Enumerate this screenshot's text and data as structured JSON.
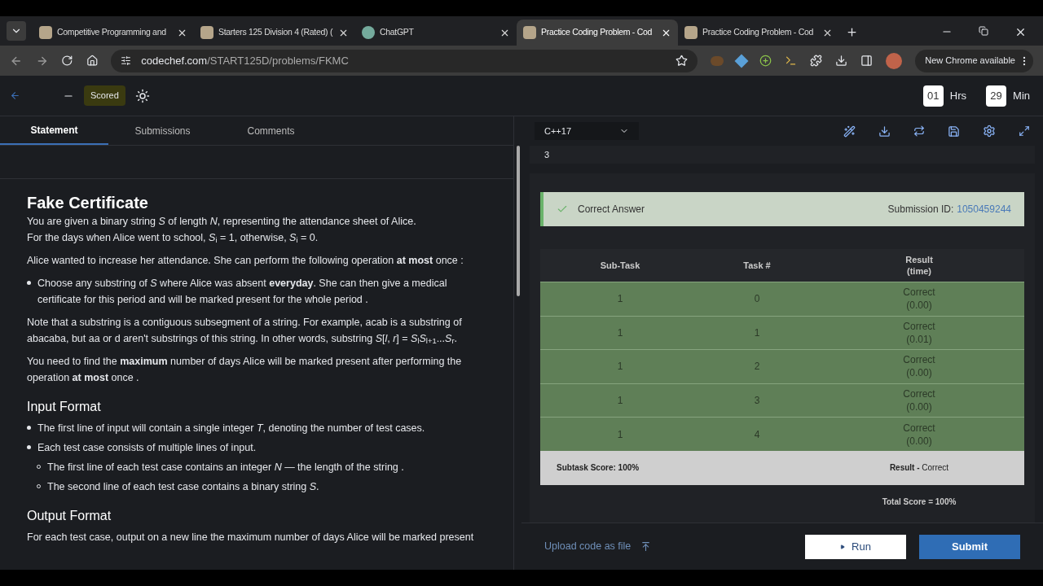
{
  "browser": {
    "tabs": [
      {
        "title": "Competitive Programming and",
        "selected": false
      },
      {
        "title": "Starters 125 Division 4 (Rated) (",
        "selected": false
      },
      {
        "title": "ChatGPT",
        "selected": false
      },
      {
        "title": "Practice Coding Problem - Cod",
        "selected": true
      },
      {
        "title": "Practice Coding Problem - Cod",
        "selected": false
      }
    ],
    "url_domain": "codechef.com",
    "url_path": "/START125D/problems/FKMC",
    "update_label": "New Chrome available"
  },
  "header": {
    "badge": "Scored",
    "timer": [
      {
        "value": "01",
        "unit": "Hrs"
      },
      {
        "value": "29",
        "unit": "Min"
      }
    ]
  },
  "left_tabs": [
    {
      "label": "Statement",
      "selected": true
    },
    {
      "label": "Submissions",
      "selected": false
    },
    {
      "label": "Comments",
      "selected": false
    }
  ],
  "problem": {
    "title": "Fake Certificate",
    "blocks": [
      {
        "kind": "para",
        "lines": [
          "You are given a binary string *S* of length *N*, representing the attendance sheet of Alice.",
          "For the days when Alice went to school, *S*$_{i}$ = 1, otherwise, *S*$_{i}$ = 0."
        ]
      },
      {
        "kind": "para",
        "lines": [
          "Alice wanted to increase her attendance. She can perform the following operation **at most** once :"
        ]
      },
      {
        "kind": "bullets",
        "items": [
          {
            "text": "Choose any substring of *S* where Alice was absent **everyday**. She can then give a medical certificate for this period and will be marked present for the whole period ."
          }
        ]
      },
      {
        "kind": "para",
        "lines": [
          "Note that a substring is a contiguous subsegment of a string. For example, acab is a substring of abacaba, but aa or d aren't substrings of this string. In other words, substring *S*[*l*, *r*] = *S*$_{l}$*S*$_{l+1}$...*S*$_{r}$."
        ]
      },
      {
        "kind": "para",
        "lines": [
          "You need to find the **maximum** number of days Alice will be marked present after performing the operation **at most** once ."
        ]
      },
      {
        "kind": "heading",
        "text": "Input Format"
      },
      {
        "kind": "bullets",
        "items": [
          {
            "text": "The first line of input will contain a single integer *T*, denoting the number of test cases."
          },
          {
            "text": "Each test case consists of multiple lines of input.",
            "children": [
              {
                "text": "The first line of each test case contains an integer *N* — the length of the string ."
              },
              {
                "text": "The second line of each test case contains a binary string *S*."
              }
            ]
          }
        ]
      },
      {
        "kind": "heading",
        "text": "Output Format"
      },
      {
        "kind": "para",
        "lines": [
          "For each test case, output on a new line the maximum number of days Alice will be marked present"
        ]
      }
    ]
  },
  "editor": {
    "language": "C++17",
    "output": "3"
  },
  "result": {
    "status": "Correct Answer",
    "submission_label": "Submission ID:",
    "submission_id": "1050459244",
    "columns": [
      "Sub-Task",
      "Task #",
      "Result",
      "(time)"
    ],
    "rows": [
      {
        "subtask": "1",
        "task": "0",
        "result": "Correct",
        "time": "(0.00)"
      },
      {
        "subtask": "1",
        "task": "1",
        "result": "Correct",
        "time": "(0.01)"
      },
      {
        "subtask": "1",
        "task": "2",
        "result": "Correct",
        "time": "(0.00)"
      },
      {
        "subtask": "1",
        "task": "3",
        "result": "Correct",
        "time": "(0.00)"
      },
      {
        "subtask": "1",
        "task": "4",
        "result": "Correct",
        "time": "(0.00)"
      }
    ],
    "subtask_score": "Subtask Score: 100%",
    "result_label": "Result -",
    "result_value": "Correct",
    "total": "Total Score = 100%"
  },
  "footer": {
    "upload": "Upload code as file",
    "run": "Run",
    "submit": "Submit"
  }
}
